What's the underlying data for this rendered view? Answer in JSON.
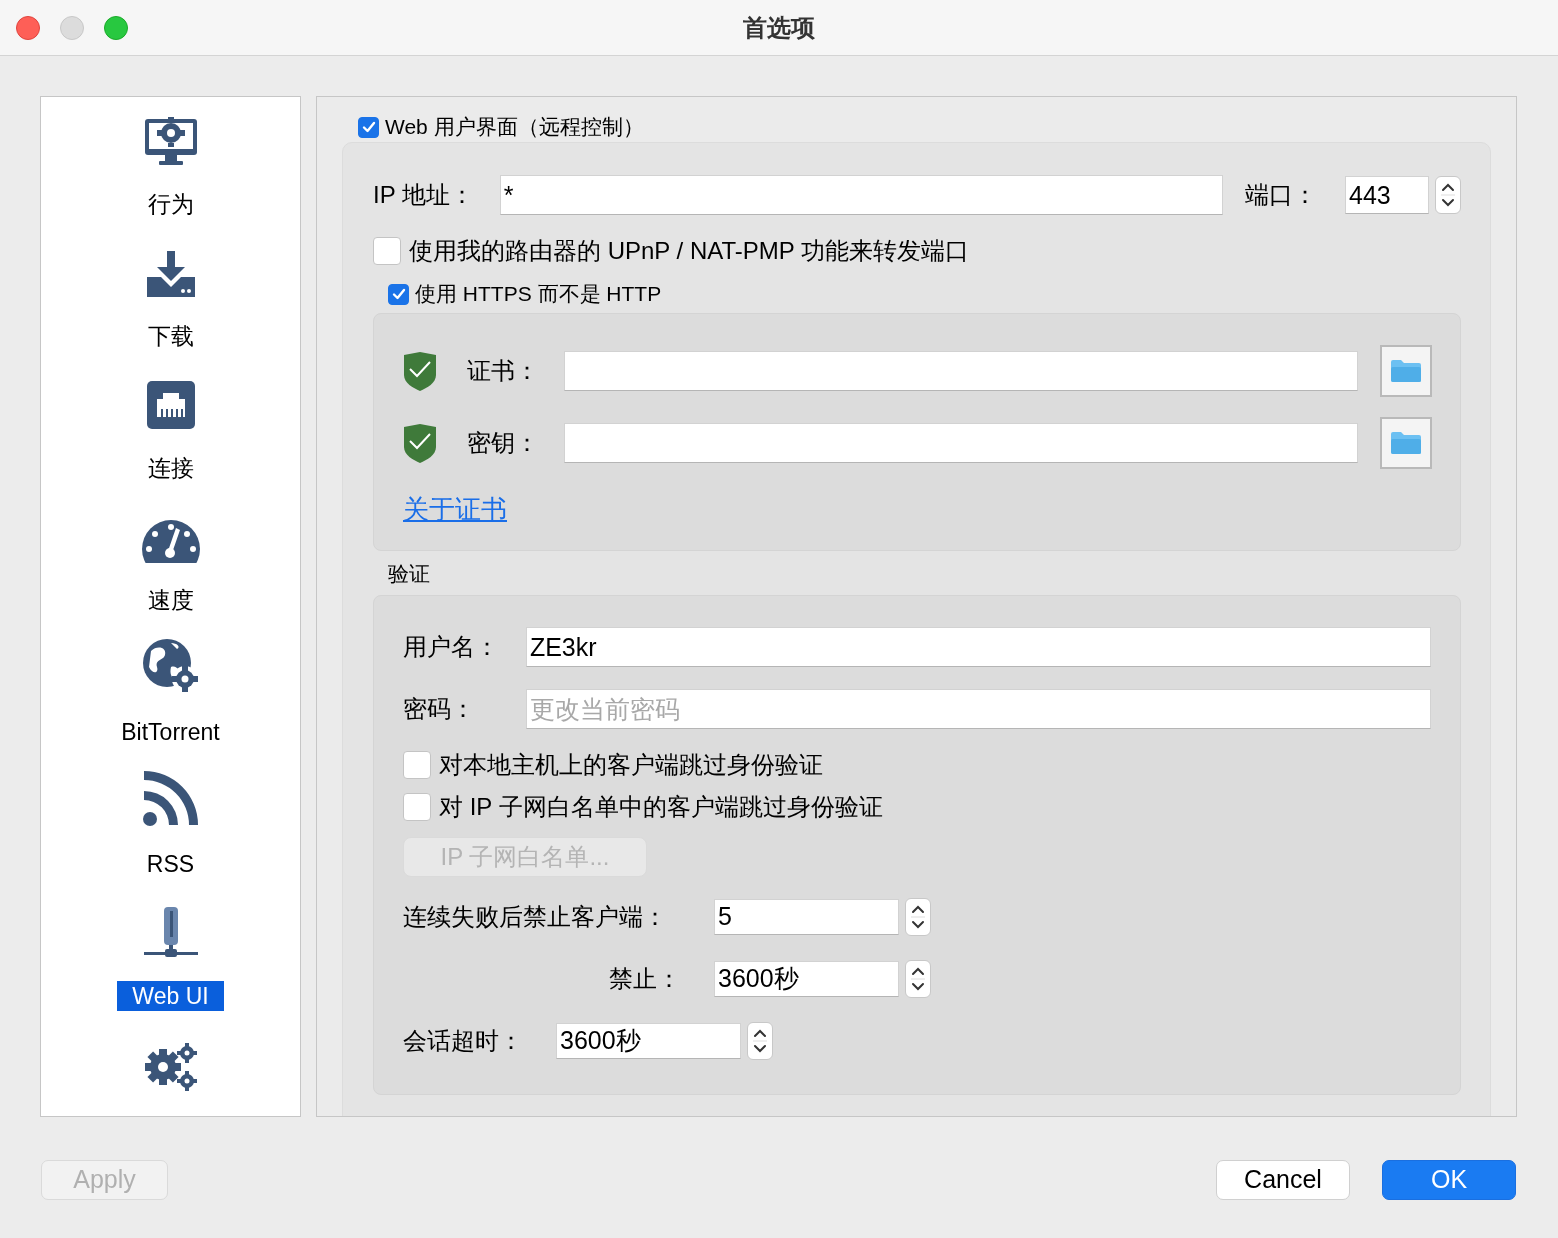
{
  "window": {
    "title": "首选项"
  },
  "sidebar": {
    "items": [
      {
        "kind": "behavior",
        "label": "行为",
        "selected": false
      },
      {
        "kind": "downloads",
        "label": "下载",
        "selected": false
      },
      {
        "kind": "connection",
        "label": "连接",
        "selected": false
      },
      {
        "kind": "speed",
        "label": "速度",
        "selected": false
      },
      {
        "kind": "bittorrent",
        "label": "BitTorrent",
        "selected": false
      },
      {
        "kind": "rss",
        "label": "RSS",
        "selected": false
      },
      {
        "kind": "webui",
        "label": "Web UI",
        "selected": true
      },
      {
        "kind": "advanced",
        "selected": false
      }
    ]
  },
  "web_ui": {
    "enabled": {
      "label": "Web 用户界面（远程控制）",
      "checked": true
    },
    "ip_address": {
      "label": "IP 地址：",
      "value": "*"
    },
    "port": {
      "label": "端口：",
      "value": "443"
    },
    "upnp": {
      "label": "使用我的路由器的 UPnP / NAT-PMP 功能来转发端口",
      "checked": false
    },
    "https": {
      "label": "使用 HTTPS 而不是 HTTP",
      "checked": true,
      "certificate": {
        "label": "证书："
      },
      "key": {
        "label": "密钥："
      },
      "link": "关于证书"
    },
    "authentication": {
      "title": "验证",
      "username": {
        "label": "用户名：",
        "value": "ZE3kr"
      },
      "password": {
        "label": "密码：",
        "placeholder": "更改当前密码"
      },
      "options": [
        {
          "label": "对本地主机上的客户端跳过身份验证",
          "checked": false
        },
        {
          "label": "对 IP 子网白名单中的客户端跳过身份验证",
          "checked": false
        }
      ],
      "whitelist_button": {
        "label": "IP 子网白名单...",
        "disabled": true
      },
      "ban_after": {
        "label": "连续失败后禁止客户端：",
        "value": "5"
      },
      "ban_duration": {
        "label": "禁止：",
        "value": "3600秒"
      },
      "session_timeout": {
        "label": "会话超时：",
        "value": "3600秒"
      }
    }
  },
  "buttons": [
    {
      "kind": "secondary",
      "label": "Apply",
      "disabled": true
    },
    {
      "kind": "secondary",
      "label": "Cancel",
      "disabled": false
    },
    {
      "kind": "primary",
      "label": "OK",
      "disabled": false
    }
  ]
}
